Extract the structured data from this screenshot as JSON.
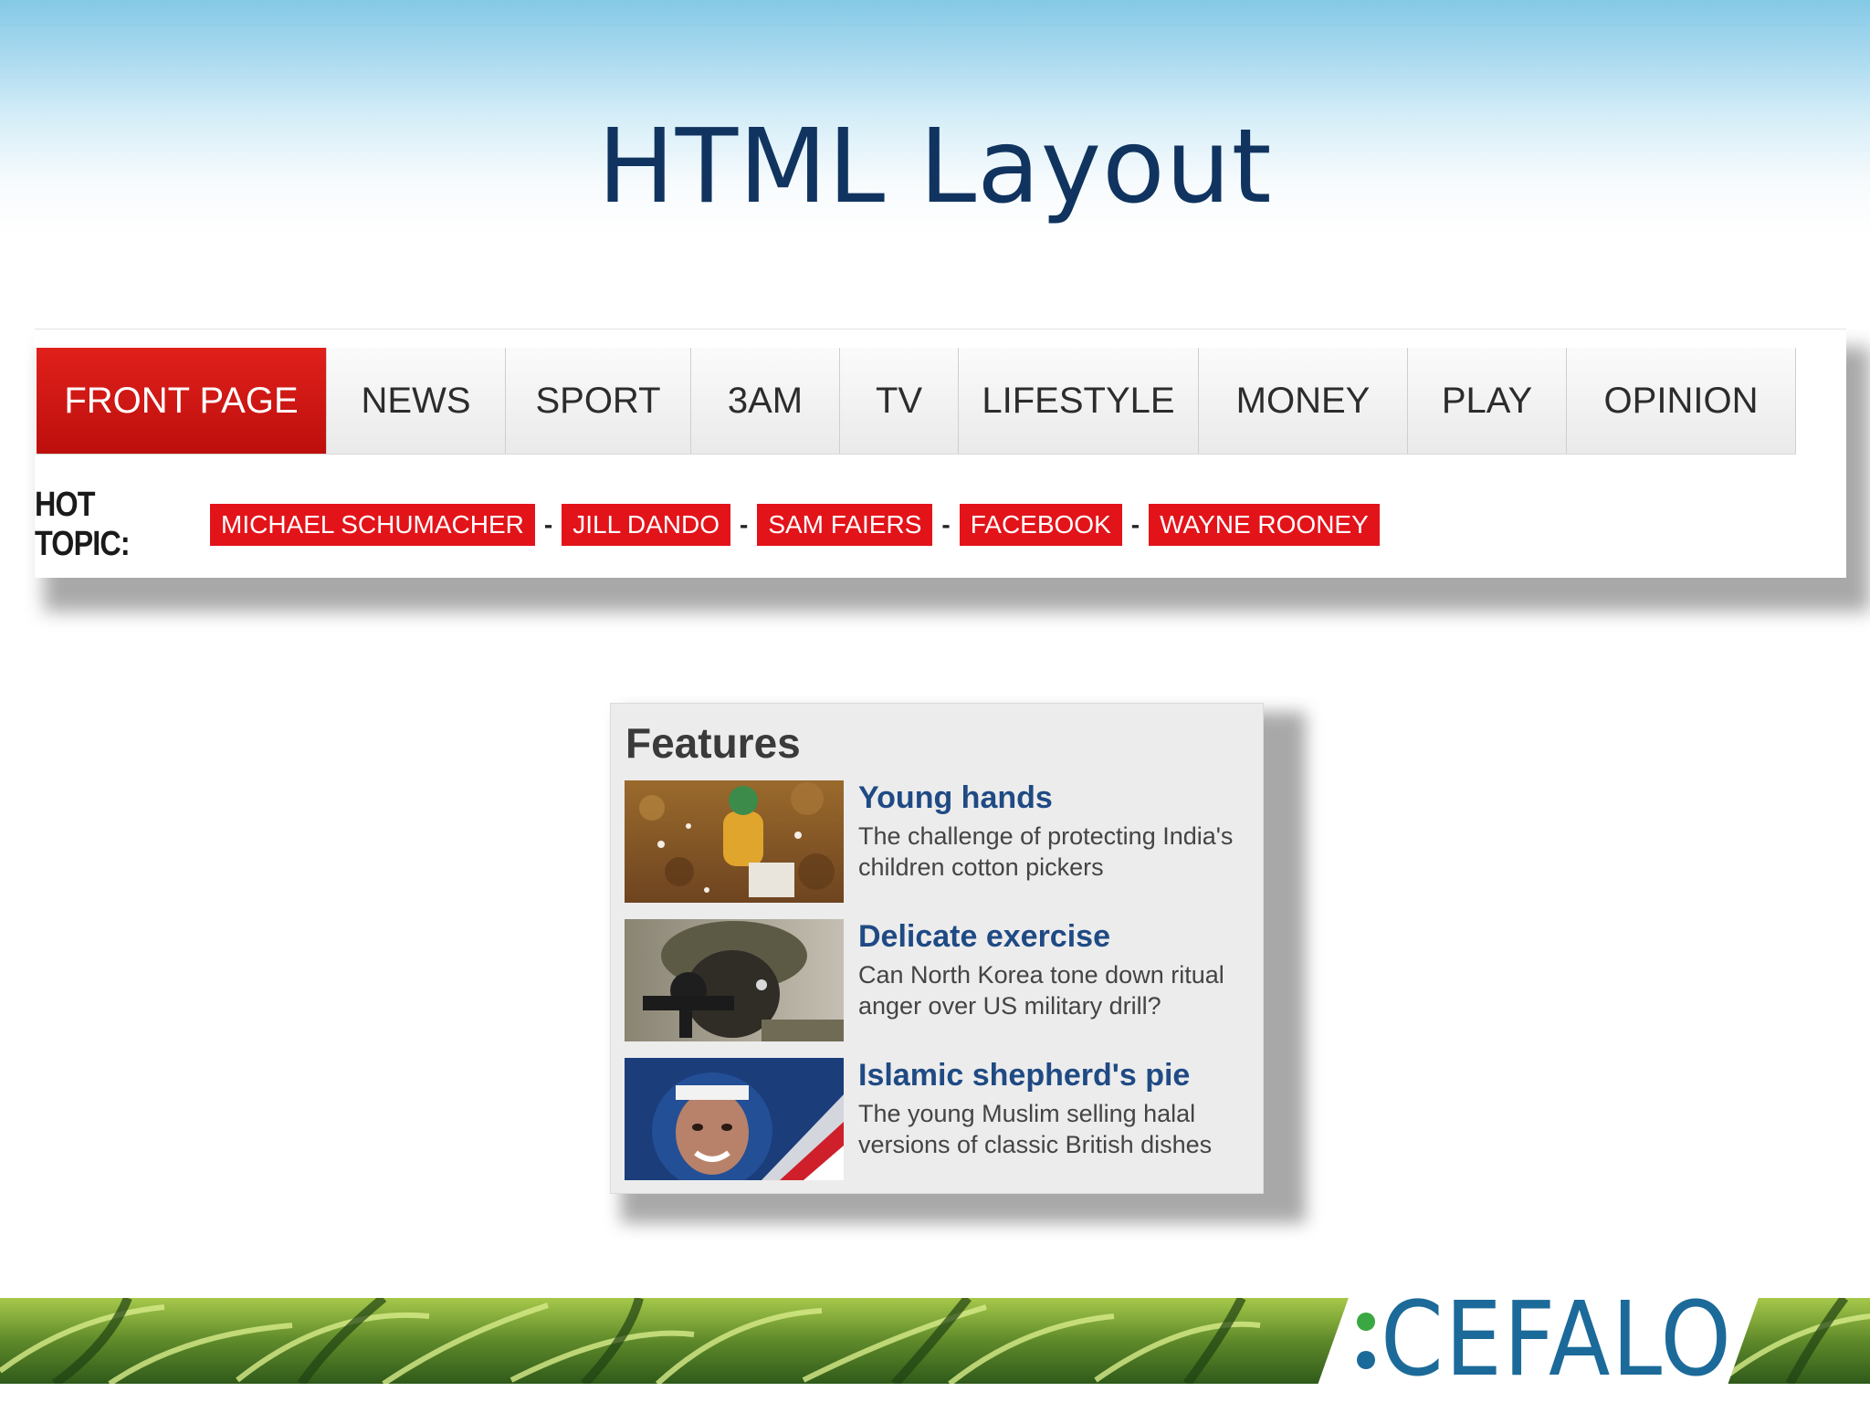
{
  "slide": {
    "title": "HTML Layout"
  },
  "nav": {
    "menu": [
      {
        "label": "FRONT PAGE",
        "active": true
      },
      {
        "label": "NEWS",
        "active": false
      },
      {
        "label": "SPORT",
        "active": false
      },
      {
        "label": "3AM",
        "active": false
      },
      {
        "label": "TV",
        "active": false
      },
      {
        "label": "LIFESTYLE",
        "active": false
      },
      {
        "label": "MONEY",
        "active": false
      },
      {
        "label": "PLAY",
        "active": false
      },
      {
        "label": "OPINION",
        "active": false
      }
    ],
    "hot_topic_label": "HOT TOPIC:",
    "hot_topics": [
      "MICHAEL SCHUMACHER",
      "JILL DANDO",
      "SAM FAIERS",
      "FACEBOOK",
      "WAYNE ROONEY"
    ],
    "separator": "-"
  },
  "features": {
    "title": "Features",
    "items": [
      {
        "headline": "Young hands",
        "summary": "The challenge of protecting India's children cotton pickers",
        "image": "cotton-field-photo"
      },
      {
        "headline": "Delicate exercise",
        "summary": "Can North Korea tone down ritual anger over US military drill?",
        "image": "soldier-photo"
      },
      {
        "headline": "Islamic shepherd's pie",
        "summary": "The young Muslim selling halal versions of classic British dishes",
        "image": "woman-hijab-photo"
      }
    ]
  },
  "footer": {
    "brand": "CEFALO"
  },
  "colors": {
    "title": "#10345f",
    "nav_active": "#e0201b",
    "tag_red": "#e3131a",
    "headline_blue": "#1f4a84",
    "brand_blue": "#1c6a99",
    "brand_dot_green": "#3aa842"
  }
}
